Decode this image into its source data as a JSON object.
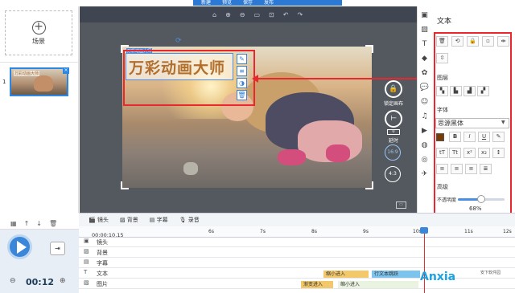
{
  "topbar": {
    "items": [
      "新建",
      "预览",
      "保存",
      "发布"
    ]
  },
  "scene": {
    "add_label": "场景",
    "index": "1",
    "thumb_title": "万彩动画大师"
  },
  "scene_tools": [
    "▦",
    "↑",
    "↓",
    "🗑"
  ],
  "stage_toolbar": [
    "⌂",
    "⊕",
    "⊖",
    "▭",
    "⊡",
    "↶",
    "↷"
  ],
  "canvas": {
    "title_text": "万彩动画大师",
    "title_label": "万彩动画大师"
  },
  "stage_side": {
    "lock_label": "锁定画布",
    "delay_label": "延时",
    "delay_value": "0",
    "ratio_169": "16:9",
    "ratio_43": "4:3"
  },
  "props": {
    "title": "文本",
    "layer_label": "图层",
    "font_label": "字体",
    "font_name": "思源黑体",
    "advanced_label": "高级",
    "opacity_label": "不透明度",
    "opacity_value": "68%",
    "opacity_level": 0.68
  },
  "timeline_tabs": [
    "镜头",
    "背景",
    "字幕",
    "录音"
  ],
  "timeline": {
    "current_time": "00:00:10.15",
    "total_time": "00:12",
    "ticks": [
      "6s",
      "7s",
      "8s",
      "9s",
      "10s",
      "11s",
      "12s"
    ],
    "tracks": [
      "镜头",
      "背景",
      "字幕",
      "文本",
      "图片"
    ],
    "bars": [
      {
        "label": "缩小进入",
        "track": 3
      },
      {
        "label": "行文本跳跃",
        "track": 3
      },
      {
        "label": "缩小进入",
        "track": 4
      },
      {
        "label": "渐变进入",
        "track": 4
      }
    ]
  },
  "watermark": {
    "brand": "Anxia",
    "sub": "安下软件园"
  },
  "colors": {
    "accent": "#2b79d4",
    "highlight": "#e8282e",
    "title_text": "#b16e2d"
  }
}
